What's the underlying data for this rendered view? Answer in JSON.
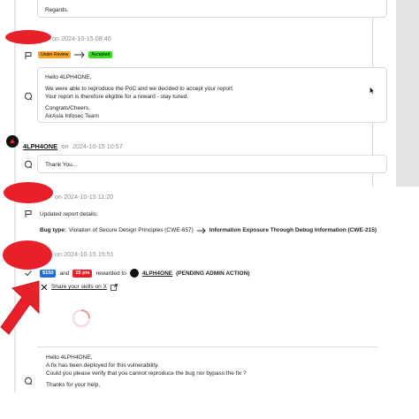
{
  "msg1": {
    "line": "Regards."
  },
  "event1": {
    "date_prefix": "on",
    "date": "2024-10-15 08:40",
    "from_status": "Under Review",
    "to_status": "Accepted",
    "lines": [
      "Hello 4LPH4ONE,",
      "",
      "We were able to reproduce the PoC and we decided to accept your report.",
      "Your report is therefore eligible for a reward - stay tuned.",
      "",
      "Congrats/Cheers,",
      "AirAsia Infosec Team"
    ]
  },
  "event2": {
    "user": "4LPH4ONE",
    "date_prefix": "on",
    "date": "2024-10-15 10:57",
    "message": "Thank You..."
  },
  "event3": {
    "date_prefix": "on",
    "date": "2024-10-15 11:20",
    "heading": "Updated report details:",
    "bug_type_label": "Bug type:",
    "old_value": "Violation of Secure Design Principles (CWE-657)",
    "new_value": "Information Exposure Through Debug Information (CWE-215)"
  },
  "event4": {
    "date_prefix": "on",
    "date": "2024-10-15 15:51",
    "bounty": "$150",
    "conj": "and",
    "points": "15 pts",
    "rewarded_to": "rewarded to",
    "user": "4LPH4ONE",
    "status": "(PENDING ADMIN ACTION)",
    "share_label": "Share your skills on X"
  },
  "msg5": {
    "lines": [
      "Hello 4LPH4ONE,",
      "A fix has been deployed for this vulnerability.",
      "Could you please verify that you cannot reproduce the bug nor bypass the fix ?",
      "",
      "Thanks for your help,"
    ]
  },
  "colors": {
    "under_review": "#f5a623",
    "accepted": "#3ddc2a",
    "bounty": "#1f6fd6",
    "points": "#e8202a",
    "redaction": "#e8202a",
    "arrow": "#e8202a"
  }
}
